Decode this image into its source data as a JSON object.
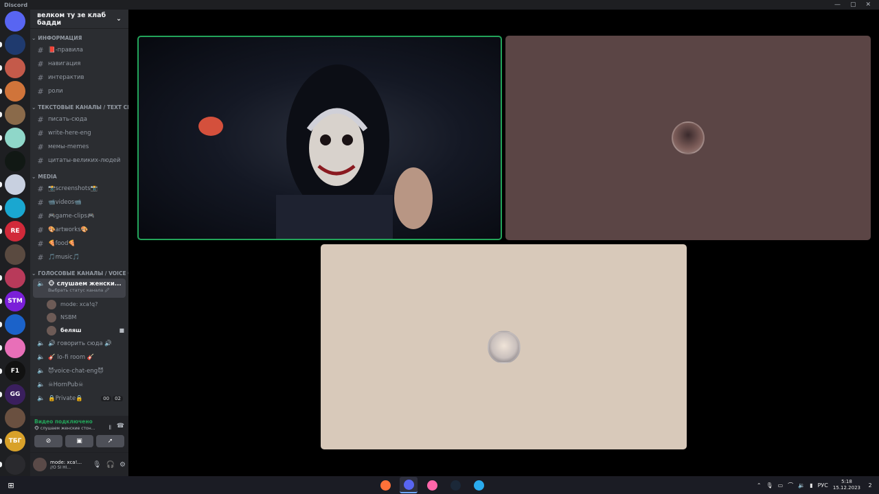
{
  "window": {
    "app_title": "Discord",
    "controls": [
      "—",
      "▢",
      "✕"
    ]
  },
  "servers": [
    {
      "icon": "discord-home-icon",
      "color": "#5865f2",
      "label": "",
      "pip": false
    },
    {
      "color": "#1f3a6e",
      "label": "",
      "pip": true
    },
    {
      "color": "#c45a4a",
      "label": "",
      "pip": true
    },
    {
      "color": "#d0743a",
      "label": "",
      "pip": true
    },
    {
      "color": "#8a6a4a",
      "label": "",
      "pip": true
    },
    {
      "color": "#8fd7c9",
      "label": "",
      "pip": true
    },
    {
      "color": "#111814",
      "label": "",
      "pip": false
    },
    {
      "color": "#c8d0e0",
      "label": "",
      "pip": true
    },
    {
      "color": "#1aa7d0",
      "label": "",
      "pip": true
    },
    {
      "color": "#d12a3a",
      "label": "RE",
      "pip": true
    },
    {
      "color": "#5a4a40",
      "label": "",
      "pip": false
    },
    {
      "color": "#b83a5a",
      "label": "",
      "pip": true
    },
    {
      "color": "#7a1fd8",
      "label": "STM",
      "pip": true
    },
    {
      "color": "#1b62c9",
      "label": "",
      "pip": true
    },
    {
      "color": "#e86fb8",
      "label": "",
      "pip": true
    },
    {
      "color": "#111",
      "label": "F1",
      "pip": true
    },
    {
      "color": "#3a1f5e",
      "label": "GG",
      "pip": true
    },
    {
      "color": "#6a5040",
      "label": "",
      "pip": false
    },
    {
      "color": "#d8a12a",
      "label": "ТБГ",
      "pip": true
    },
    {
      "color": "#2a2a2e",
      "label": "",
      "pip": true
    }
  ],
  "guild": {
    "name": "велком ту зе клаб бадди"
  },
  "categories": [
    {
      "name": "ИНФОРМАЦИЯ",
      "channels": [
        {
          "type": "text",
          "name": "📕-правила"
        },
        {
          "type": "text",
          "name": "навигация"
        },
        {
          "type": "text",
          "name": "интерактив"
        },
        {
          "type": "text",
          "name": "роли"
        }
      ]
    },
    {
      "name": "ТЕКСТОВЫЕ КАНАЛЫ / TEXT CHAT",
      "channels": [
        {
          "type": "text",
          "name": "писать-сюда"
        },
        {
          "type": "text",
          "name": "write-here-eng"
        },
        {
          "type": "text",
          "name": "мемы-memes"
        },
        {
          "type": "text",
          "name": "цитаты-великих-людей"
        }
      ]
    },
    {
      "name": "MEDIA",
      "channels": [
        {
          "type": "text",
          "name": "📸screenshots📸"
        },
        {
          "type": "text",
          "name": "📹videos📹"
        },
        {
          "type": "text",
          "name": "🎮game-clips🎮"
        },
        {
          "type": "text",
          "name": "🎨artworks🎨"
        },
        {
          "type": "text",
          "name": "🍕food🍕"
        },
        {
          "type": "text",
          "name": "🎵music🎵"
        }
      ]
    }
  ],
  "voice_category": "ГОЛОСОВЫЕ КАНАЛЫ / VOICE CH...",
  "active_voice": {
    "name": "🐵 слушаем женски...",
    "status": "Выбрать статус канала 🖉"
  },
  "voice_users": [
    {
      "name": "mode: xca!q?",
      "bold": false,
      "cam": false
    },
    {
      "name": "NSBM",
      "bold": false,
      "cam": false
    },
    {
      "name": "беляш",
      "bold": true,
      "cam": true
    }
  ],
  "voice_channels": [
    {
      "name": "🔊 говорить сюда 🔊"
    },
    {
      "name": "🎸 lo-fi room 🎸"
    },
    {
      "name": "😈voice-chat-eng😈"
    },
    {
      "name": "☠HornPub☠"
    },
    {
      "name": "🔒Private🔒",
      "counter": [
        "00",
        "02"
      ]
    }
  ],
  "voice_panel": {
    "status": "Видео подключено",
    "channel": "🐵 слушаем женские стон..."
  },
  "user": {
    "name": "mode: xca!...",
    "status": "//O SI HI..."
  },
  "taskbar": {
    "apps": [
      {
        "icon": "firefox-icon",
        "color": "#ff7139",
        "active": false
      },
      {
        "icon": "discord-icon",
        "color": "#5865f2",
        "active": true
      },
      {
        "icon": "osu-icon",
        "color": "#ff66aa",
        "active": false
      },
      {
        "icon": "steam-icon",
        "color": "#1b2838",
        "active": false
      },
      {
        "icon": "telegram-icon",
        "color": "#2aabee",
        "active": false
      }
    ],
    "lang": "РУС",
    "time": "5:18",
    "date": "15.12.2023",
    "notifications": "2"
  }
}
